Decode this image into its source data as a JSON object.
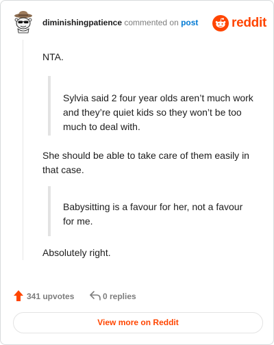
{
  "header": {
    "username": "diminishingpatience",
    "action": "commented on",
    "post_link": "post",
    "brand": "reddit"
  },
  "comment": {
    "p1": "NTA.",
    "quote1": "Sylvia said 2 four year olds aren’t much work and they’re quiet kids so they won’t be too much to deal with.",
    "p2": "She should be able to take care of them easily in that case.",
    "quote2": "Babysitting is a favour for her, not a favour for me.",
    "p3": "Absolutely right."
  },
  "footer": {
    "upvotes": "341 upvotes",
    "replies": "0 replies",
    "upvote_icon": "upvote-arrow-icon",
    "reply_icon": "reply-arrow-icon"
  },
  "view_more_label": "View more on Reddit",
  "colors": {
    "brand": "#ff4500",
    "link": "#0079d3",
    "muted": "#7c7c7c"
  }
}
